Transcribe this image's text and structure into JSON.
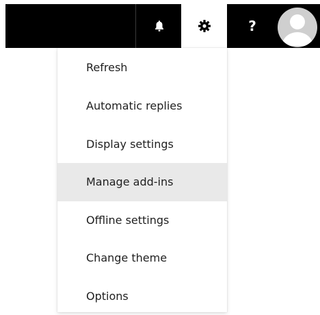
{
  "topbar": {
    "icons": {
      "notifications": "bell-icon",
      "settings": "gear-icon",
      "help": "question-icon",
      "account": "avatar-icon"
    },
    "help_label": "?",
    "colors": {
      "bar": "#000000",
      "active": "#ffffff",
      "avatar": "#cfcfcf"
    }
  },
  "menu": {
    "items": [
      {
        "label": "Refresh"
      },
      {
        "label": "Automatic replies"
      },
      {
        "label": "Display settings"
      },
      {
        "label": "Manage add-ins",
        "highlighted": true
      },
      {
        "label": "Offline settings"
      },
      {
        "label": "Change theme"
      },
      {
        "label": "Options"
      }
    ],
    "colors": {
      "highlight": "#e9e9e9",
      "text": "#1f1f1f"
    }
  }
}
